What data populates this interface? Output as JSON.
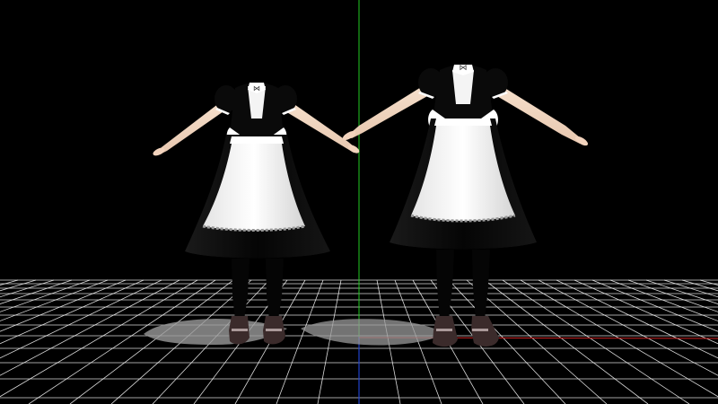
{
  "viewport": {
    "background_color": "#000000",
    "grid_color": "#ffffff",
    "axis_colors": {
      "y_axis": "#22cc22",
      "x_axis": "#cc2222",
      "z_axis": "#2244cc"
    }
  },
  "models": [
    {
      "name": "",
      "icon": "maid-dress-model-left"
    },
    {
      "name": "",
      "icon": "maid-dress-model-right"
    }
  ],
  "colors": {
    "dress": "#0a0a0a",
    "apron": "#f2f2f2",
    "apron_shade": "#d8d8d8",
    "skin": "#f3d9c4",
    "stockings": "#050505",
    "shoes": "#3a2a2a",
    "lace": "#bfbfbf",
    "shadow": "#9a9a9a"
  }
}
